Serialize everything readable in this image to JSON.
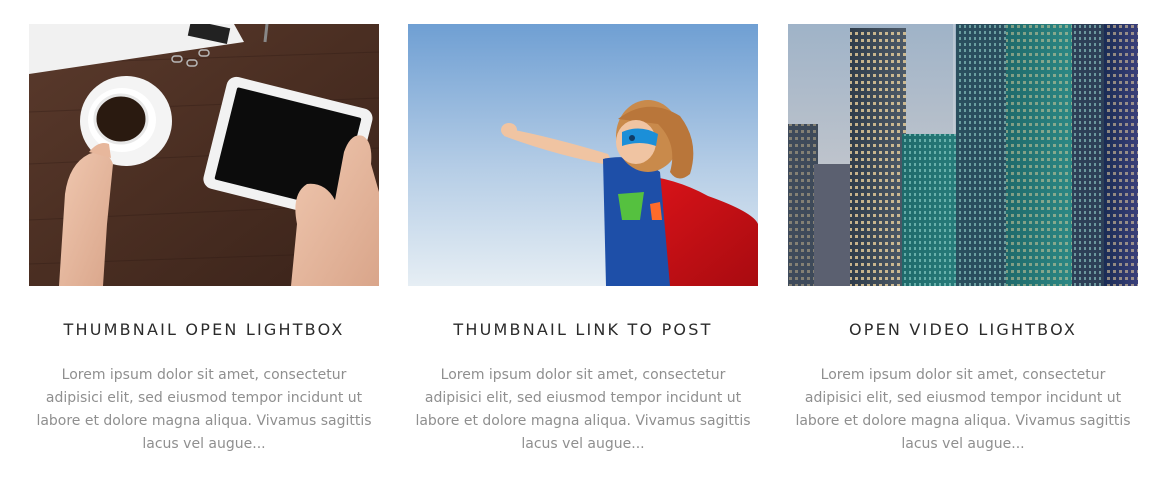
{
  "cards": [
    {
      "title": "THUMBNAIL OPEN LIGHTBOX",
      "excerpt": "Lorem ipsum dolor sit amet, consectetur adipisici elit, sed eiusmod tempor incidunt ut labore et dolore magna aliqua. Vivamus sagittis lacus vel augue...",
      "image": "desk-coffee-tablet-photo"
    },
    {
      "title": "THUMBNAIL LINK TO POST",
      "excerpt": "Lorem ipsum dolor sit amet, consectetur adipisici elit, sed eiusmod tempor incidunt ut labore et dolore magna aliqua. Vivamus sagittis lacus vel augue...",
      "image": "superhero-kid-sky-photo"
    },
    {
      "title": "OPEN VIDEO LIGHTBOX",
      "excerpt": "Lorem ipsum dolor sit amet, consectetur adipisici elit, sed eiusmod tempor incidunt ut labore et dolore magna aliqua. Vivamus sagittis lacus vel augue...",
      "image": "city-skyscrapers-photo"
    }
  ],
  "colors": {
    "title": "#2b2b2b",
    "excerpt": "#8f8f8f",
    "background": "#ffffff"
  }
}
